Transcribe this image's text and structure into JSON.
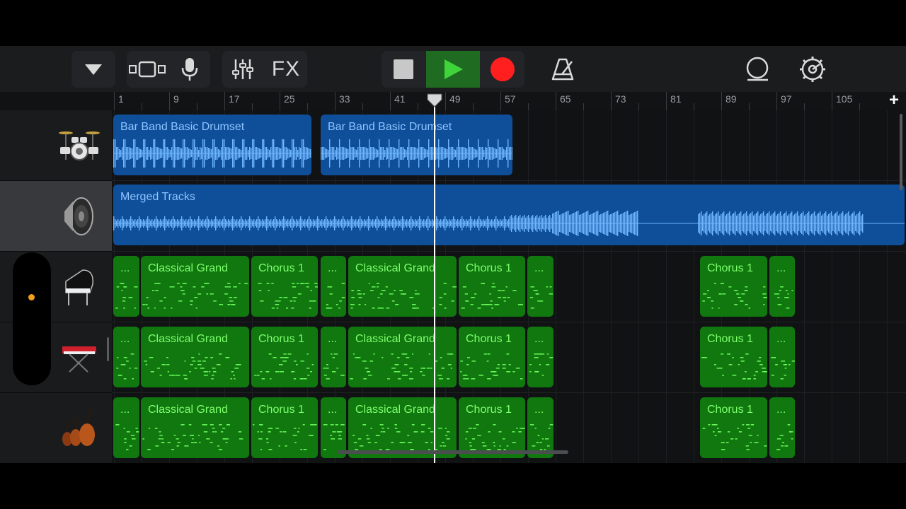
{
  "toolbar": {
    "fx_label": "FX",
    "icons": [
      "tracks-dropdown-icon",
      "track-view-icon",
      "microphone-icon",
      "mixer-icon",
      "stop-icon",
      "play-icon",
      "record-icon",
      "metronome-icon",
      "loop-browser-icon",
      "settings-icon"
    ],
    "colors": {
      "play": "#3fd43a",
      "record": "#ff1f1f",
      "stop": "#c8c8c8",
      "play_bg": "#1f6b22"
    }
  },
  "ruler": {
    "labels": [
      "1",
      "9",
      "17",
      "25",
      "33",
      "41",
      "49",
      "57",
      "65",
      "73",
      "81",
      "89",
      "97",
      "105"
    ],
    "add_label": "+"
  },
  "tracks": [
    {
      "instrument": "drumset-icon"
    },
    {
      "instrument": "speaker-icon",
      "selected": true
    },
    {
      "instrument": "grand-piano-icon"
    },
    {
      "instrument": "synth-keyboard-icon"
    },
    {
      "instrument": "strings-icon"
    }
  ],
  "regions": {
    "drums": [
      {
        "name": "Bar Band Basic Drumset"
      },
      {
        "name": "Bar Band Basic Drumset"
      }
    ],
    "merged": {
      "name": "Merged Tracks"
    },
    "midi_row": [
      {
        "name": "..."
      },
      {
        "name": "Classical Grand"
      },
      {
        "name": "Chorus 1"
      },
      {
        "name": "..."
      },
      {
        "name": "Classical Grand"
      },
      {
        "name": "Chorus 1"
      },
      {
        "name": "..."
      },
      {
        "name": "Chorus 1"
      },
      {
        "name": "..."
      }
    ]
  },
  "playhead": {
    "bar": 47
  }
}
